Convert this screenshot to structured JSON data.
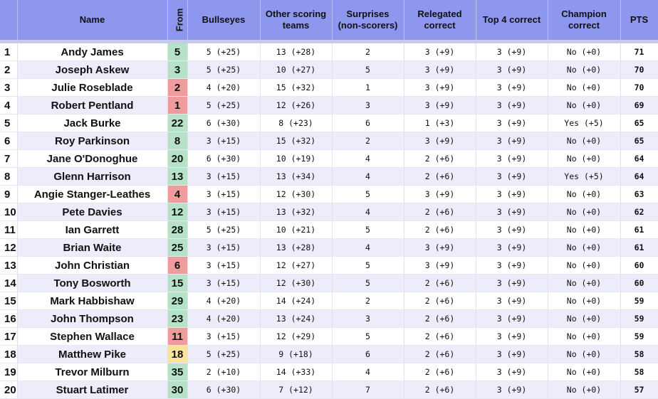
{
  "headers": {
    "name": "Name",
    "from": "From",
    "bullseyes": "Bullseyes",
    "other1": "Other scoring",
    "other2": "teams",
    "surprises1": "Surprises",
    "surprises2": "(non-scorers)",
    "relegated1": "Relegated",
    "relegated2": "correct",
    "top4": "Top 4 correct",
    "champion1": "Champion",
    "champion2": "correct",
    "pts": "PTS"
  },
  "colors": {
    "header_bg": "#8e97ee",
    "row_alt": "#ececfb",
    "from_up": "#b6e3c8",
    "from_down": "#ee9c9c",
    "from_same": "#fbe39a"
  },
  "rows": [
    {
      "rank": "1",
      "name": "Andy James",
      "from": "5",
      "from_status": "up",
      "bullseyes": "5 (+25)",
      "other": "13 (+28)",
      "surprises": "2",
      "relegated": "3 (+9)",
      "top4": "3 (+9)",
      "champion": "No (+0)",
      "pts": "71"
    },
    {
      "rank": "2",
      "name": "Joseph Askew",
      "from": "3",
      "from_status": "up",
      "bullseyes": "5 (+25)",
      "other": "10 (+27)",
      "surprises": "5",
      "relegated": "3 (+9)",
      "top4": "3 (+9)",
      "champion": "No (+0)",
      "pts": "70"
    },
    {
      "rank": "3",
      "name": "Julie Roseblade",
      "from": "2",
      "from_status": "down",
      "bullseyes": "4 (+20)",
      "other": "15 (+32)",
      "surprises": "1",
      "relegated": "3 (+9)",
      "top4": "3 (+9)",
      "champion": "No (+0)",
      "pts": "70"
    },
    {
      "rank": "4",
      "name": "Robert Pentland",
      "from": "1",
      "from_status": "down",
      "bullseyes": "5 (+25)",
      "other": "12 (+26)",
      "surprises": "3",
      "relegated": "3 (+9)",
      "top4": "3 (+9)",
      "champion": "No (+0)",
      "pts": "69"
    },
    {
      "rank": "5",
      "name": "Jack Burke",
      "from": "22",
      "from_status": "up",
      "bullseyes": "6 (+30)",
      "other": "8 (+23)",
      "surprises": "6",
      "relegated": "1 (+3)",
      "top4": "3 (+9)",
      "champion": "Yes (+5)",
      "pts": "65"
    },
    {
      "rank": "6",
      "name": "Roy Parkinson",
      "from": "8",
      "from_status": "up",
      "bullseyes": "3 (+15)",
      "other": "15 (+32)",
      "surprises": "2",
      "relegated": "3 (+9)",
      "top4": "3 (+9)",
      "champion": "No (+0)",
      "pts": "65"
    },
    {
      "rank": "7",
      "name": "Jane O'Donoghue",
      "from": "20",
      "from_status": "up",
      "bullseyes": "6 (+30)",
      "other": "10 (+19)",
      "surprises": "4",
      "relegated": "2 (+6)",
      "top4": "3 (+9)",
      "champion": "No (+0)",
      "pts": "64"
    },
    {
      "rank": "8",
      "name": "Glenn Harrison",
      "from": "13",
      "from_status": "up",
      "bullseyes": "3 (+15)",
      "other": "13 (+34)",
      "surprises": "4",
      "relegated": "2 (+6)",
      "top4": "3 (+9)",
      "champion": "Yes (+5)",
      "pts": "64"
    },
    {
      "rank": "9",
      "name": "Angie Stanger-Leathes",
      "from": "4",
      "from_status": "down",
      "bullseyes": "3 (+15)",
      "other": "12 (+30)",
      "surprises": "5",
      "relegated": "3 (+9)",
      "top4": "3 (+9)",
      "champion": "No (+0)",
      "pts": "63"
    },
    {
      "rank": "10",
      "name": "Pete Davies",
      "from": "12",
      "from_status": "up",
      "bullseyes": "3 (+15)",
      "other": "13 (+32)",
      "surprises": "4",
      "relegated": "2 (+6)",
      "top4": "3 (+9)",
      "champion": "No (+0)",
      "pts": "62"
    },
    {
      "rank": "11",
      "name": "Ian Garrett",
      "from": "28",
      "from_status": "up",
      "bullseyes": "5 (+25)",
      "other": "10 (+21)",
      "surprises": "5",
      "relegated": "2 (+6)",
      "top4": "3 (+9)",
      "champion": "No (+0)",
      "pts": "61"
    },
    {
      "rank": "12",
      "name": "Brian Waite",
      "from": "25",
      "from_status": "up",
      "bullseyes": "3 (+15)",
      "other": "13 (+28)",
      "surprises": "4",
      "relegated": "3 (+9)",
      "top4": "3 (+9)",
      "champion": "No (+0)",
      "pts": "61"
    },
    {
      "rank": "13",
      "name": "John Christian",
      "from": "6",
      "from_status": "down",
      "bullseyes": "3 (+15)",
      "other": "12 (+27)",
      "surprises": "5",
      "relegated": "3 (+9)",
      "top4": "3 (+9)",
      "champion": "No (+0)",
      "pts": "60"
    },
    {
      "rank": "14",
      "name": "Tony Bosworth",
      "from": "15",
      "from_status": "up",
      "bullseyes": "3 (+15)",
      "other": "12 (+30)",
      "surprises": "5",
      "relegated": "2 (+6)",
      "top4": "3 (+9)",
      "champion": "No (+0)",
      "pts": "60"
    },
    {
      "rank": "15",
      "name": "Mark Habbishaw",
      "from": "29",
      "from_status": "up",
      "bullseyes": "4 (+20)",
      "other": "14 (+24)",
      "surprises": "2",
      "relegated": "2 (+6)",
      "top4": "3 (+9)",
      "champion": "No (+0)",
      "pts": "59"
    },
    {
      "rank": "16",
      "name": "John Thompson",
      "from": "23",
      "from_status": "up",
      "bullseyes": "4 (+20)",
      "other": "13 (+24)",
      "surprises": "3",
      "relegated": "2 (+6)",
      "top4": "3 (+9)",
      "champion": "No (+0)",
      "pts": "59"
    },
    {
      "rank": "17",
      "name": "Stephen Wallace",
      "from": "11",
      "from_status": "down",
      "bullseyes": "3 (+15)",
      "other": "12 (+29)",
      "surprises": "5",
      "relegated": "2 (+6)",
      "top4": "3 (+9)",
      "champion": "No (+0)",
      "pts": "59"
    },
    {
      "rank": "18",
      "name": "Matthew Pike",
      "from": "18",
      "from_status": "same",
      "bullseyes": "5 (+25)",
      "other": "9 (+18)",
      "surprises": "6",
      "relegated": "2 (+6)",
      "top4": "3 (+9)",
      "champion": "No (+0)",
      "pts": "58"
    },
    {
      "rank": "19",
      "name": "Trevor Milburn",
      "from": "35",
      "from_status": "up",
      "bullseyes": "2 (+10)",
      "other": "14 (+33)",
      "surprises": "4",
      "relegated": "2 (+6)",
      "top4": "3 (+9)",
      "champion": "No (+0)",
      "pts": "58"
    },
    {
      "rank": "20",
      "name": "Stuart Latimer",
      "from": "30",
      "from_status": "up",
      "bullseyes": "6 (+30)",
      "other": "7 (+12)",
      "surprises": "7",
      "relegated": "2 (+6)",
      "top4": "3 (+9)",
      "champion": "No (+0)",
      "pts": "57"
    }
  ]
}
